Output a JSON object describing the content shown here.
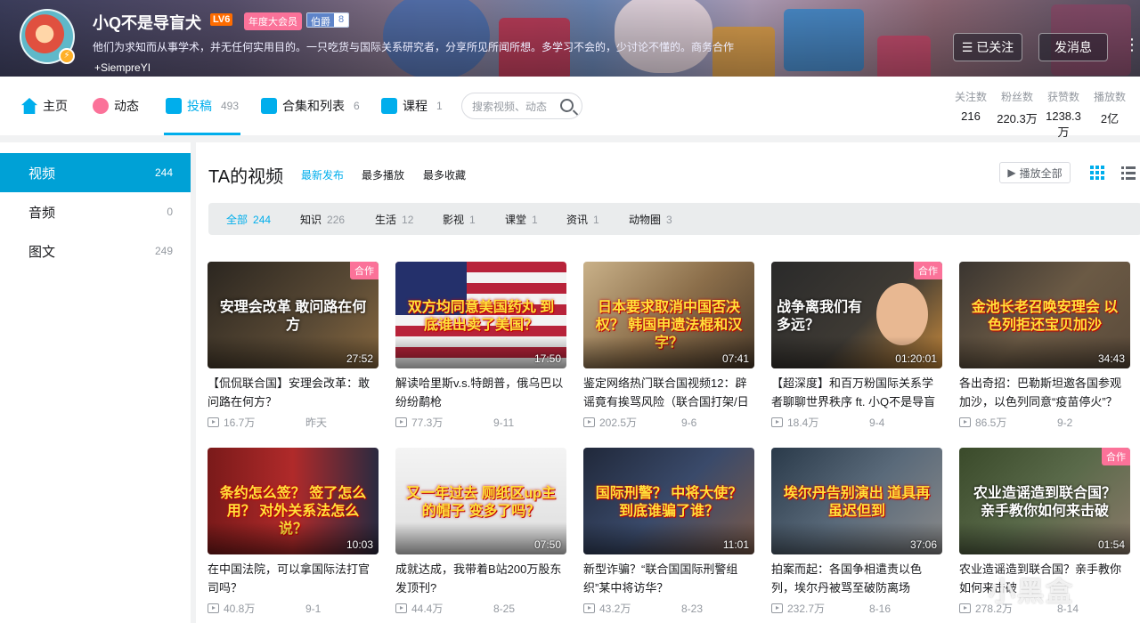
{
  "user": {
    "name": "小Q不是导盲犬",
    "level": "LV6",
    "vip": "年度大会员",
    "medal_name": "伯爵",
    "medal_level": "8",
    "sign": "他们为求知而从事学术，并无任何实用目的。一只吃货与国际关系研究者，分享所见所闻所想。多学习不会的，少讨论不懂的。商务合作",
    "extra": "+SiempreYI",
    "followed_label": "已关注",
    "message_label": "发消息"
  },
  "nav": {
    "items": [
      {
        "label": "主页",
        "count": ""
      },
      {
        "label": "动态",
        "count": ""
      },
      {
        "label": "投稿",
        "count": "493"
      },
      {
        "label": "合集和列表",
        "count": "6"
      },
      {
        "label": "课程",
        "count": "1"
      }
    ],
    "search_placeholder": "搜索视频、动态",
    "stats": [
      {
        "label": "关注数",
        "value": "216"
      },
      {
        "label": "粉丝数",
        "value": "220.3万"
      },
      {
        "label": "获赞数",
        "value": "1238.3万"
      },
      {
        "label": "播放数",
        "value": "2亿"
      }
    ]
  },
  "sidebar": {
    "items": [
      {
        "label": "视频",
        "count": "244"
      },
      {
        "label": "音频",
        "count": "0"
      },
      {
        "label": "图文",
        "count": "249"
      }
    ]
  },
  "main": {
    "title": "TA的视频",
    "sorts": [
      "最新发布",
      "最多播放",
      "最多收藏"
    ],
    "play_all": "播放全部",
    "filters": [
      {
        "label": "全部",
        "count": "244"
      },
      {
        "label": "知识",
        "count": "226"
      },
      {
        "label": "生活",
        "count": "12"
      },
      {
        "label": "影视",
        "count": "1"
      },
      {
        "label": "课堂",
        "count": "1"
      },
      {
        "label": "资讯",
        "count": "1"
      },
      {
        "label": "动物圈",
        "count": "3"
      }
    ],
    "videos": [
      {
        "thumb_text": "安理会改革 敢问路在何方",
        "duration": "27:52",
        "tag": "合作",
        "title": "【侃侃联合国】安理会改革：敢问路在何方？",
        "views": "16.7万",
        "date": "昨天"
      },
      {
        "thumb_text": "双方均同意美国药丸 到底谁出卖了美国？",
        "duration": "17:50",
        "tag": "",
        "title": "解读哈里斯v.s.特朗普，俄乌巴以纷纷鹬枪",
        "views": "77.3万",
        "date": "9-11"
      },
      {
        "thumb_text": "日本要求取消中国否决权？ 韩国申遗法棍和汉字？",
        "duration": "07:41",
        "tag": "",
        "title": "鉴定网络热门联合国视频12：辟谣竟有挨骂风险（联合国打架/日本取",
        "views": "202.5万",
        "date": "9-6"
      },
      {
        "thumb_text": "战争离我们有多远？",
        "duration": "01:20:01",
        "tag": "合作",
        "title": "【超深度】和百万粉国际关系学者聊聊世界秩序 ft. 小Q不是导盲犬 |",
        "views": "18.4万",
        "date": "9-4"
      },
      {
        "thumb_text": "金池长老召唤安理会 以色列拒还宝贝加沙",
        "duration": "34:43",
        "tag": "",
        "title": "各出奇招：巴勒斯坦邀各国参观加沙，以色列同意“疫苗停火”？",
        "views": "86.5万",
        "date": "9-2"
      },
      {
        "thumb_text": "条约怎么签？ 签了怎么用？ 对外关系法怎么说？",
        "duration": "10:03",
        "tag": "",
        "title": "在中国法院，可以拿国际法打官司吗？",
        "views": "40.8万",
        "date": "9-1"
      },
      {
        "thumb_text": "又一年过去 厕纸区up主的帽子 变多了吗？",
        "duration": "07:50",
        "tag": "",
        "title": "成就达成，我带着B站200万股东发顶刊?",
        "views": "44.4万",
        "date": "8-25"
      },
      {
        "thumb_text": "国际刑警？ 中将大使？ 到底谁骗了谁？",
        "duration": "11:01",
        "tag": "",
        "title": "新型诈骗？“联合国国际刑警组织”某中将访华？",
        "views": "43.2万",
        "date": "8-23"
      },
      {
        "thumb_text": "埃尔丹告别演出 道具再虽迟但到",
        "duration": "37:06",
        "tag": "",
        "title": "拍案而起：各国争相遣责以色列，埃尔丹被骂至破防离场",
        "views": "232.7万",
        "date": "8-16"
      },
      {
        "thumb_text": "农业造谣造到联合国？ 亲手教你如何来击破",
        "duration": "01:54",
        "tag": "合作",
        "title": "农业造谣造到联合国？亲手教你如何来击破",
        "views": "278.2万",
        "date": "8-14"
      }
    ]
  },
  "watermark": "小黑盒",
  "colors": {
    "accent": "#00aeec",
    "sidebar_active": "#00a1d6",
    "pink": "#fb7299"
  }
}
